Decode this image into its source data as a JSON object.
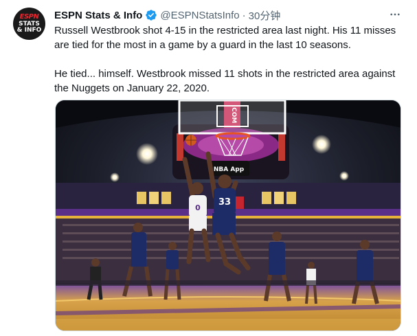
{
  "account": {
    "display_name": "ESPN Stats & Info",
    "handle": "@ESPNStatsInfo",
    "separator": "·",
    "time_ago": "30分钟",
    "avatar_text": [
      "ESPN",
      "STATS",
      "& INFO"
    ],
    "verified_color": "#1d9bf0"
  },
  "tweet": {
    "paragraph_1": "Russell Westbrook shot 4-15 in the restricted area last night. His 11 misses are tied for the most in a game by a guard in the last 10 seasons.",
    "paragraph_2": "He tied... himself. Westbrook missed 11 shots in the restricted area against the Nuggets on January 22, 2020."
  },
  "media": {
    "scoreboard_text": ".COM",
    "backboard_brand": "NBA App",
    "jersey_number_white": "0",
    "jersey_number_blue": "33",
    "colors": {
      "arena": "#14161f",
      "court": "#c98a2e",
      "purple": "#4b2a78",
      "nets_blue": "#1d2c66"
    }
  },
  "actions": {
    "more_icon": "more-horizontal-icon"
  }
}
